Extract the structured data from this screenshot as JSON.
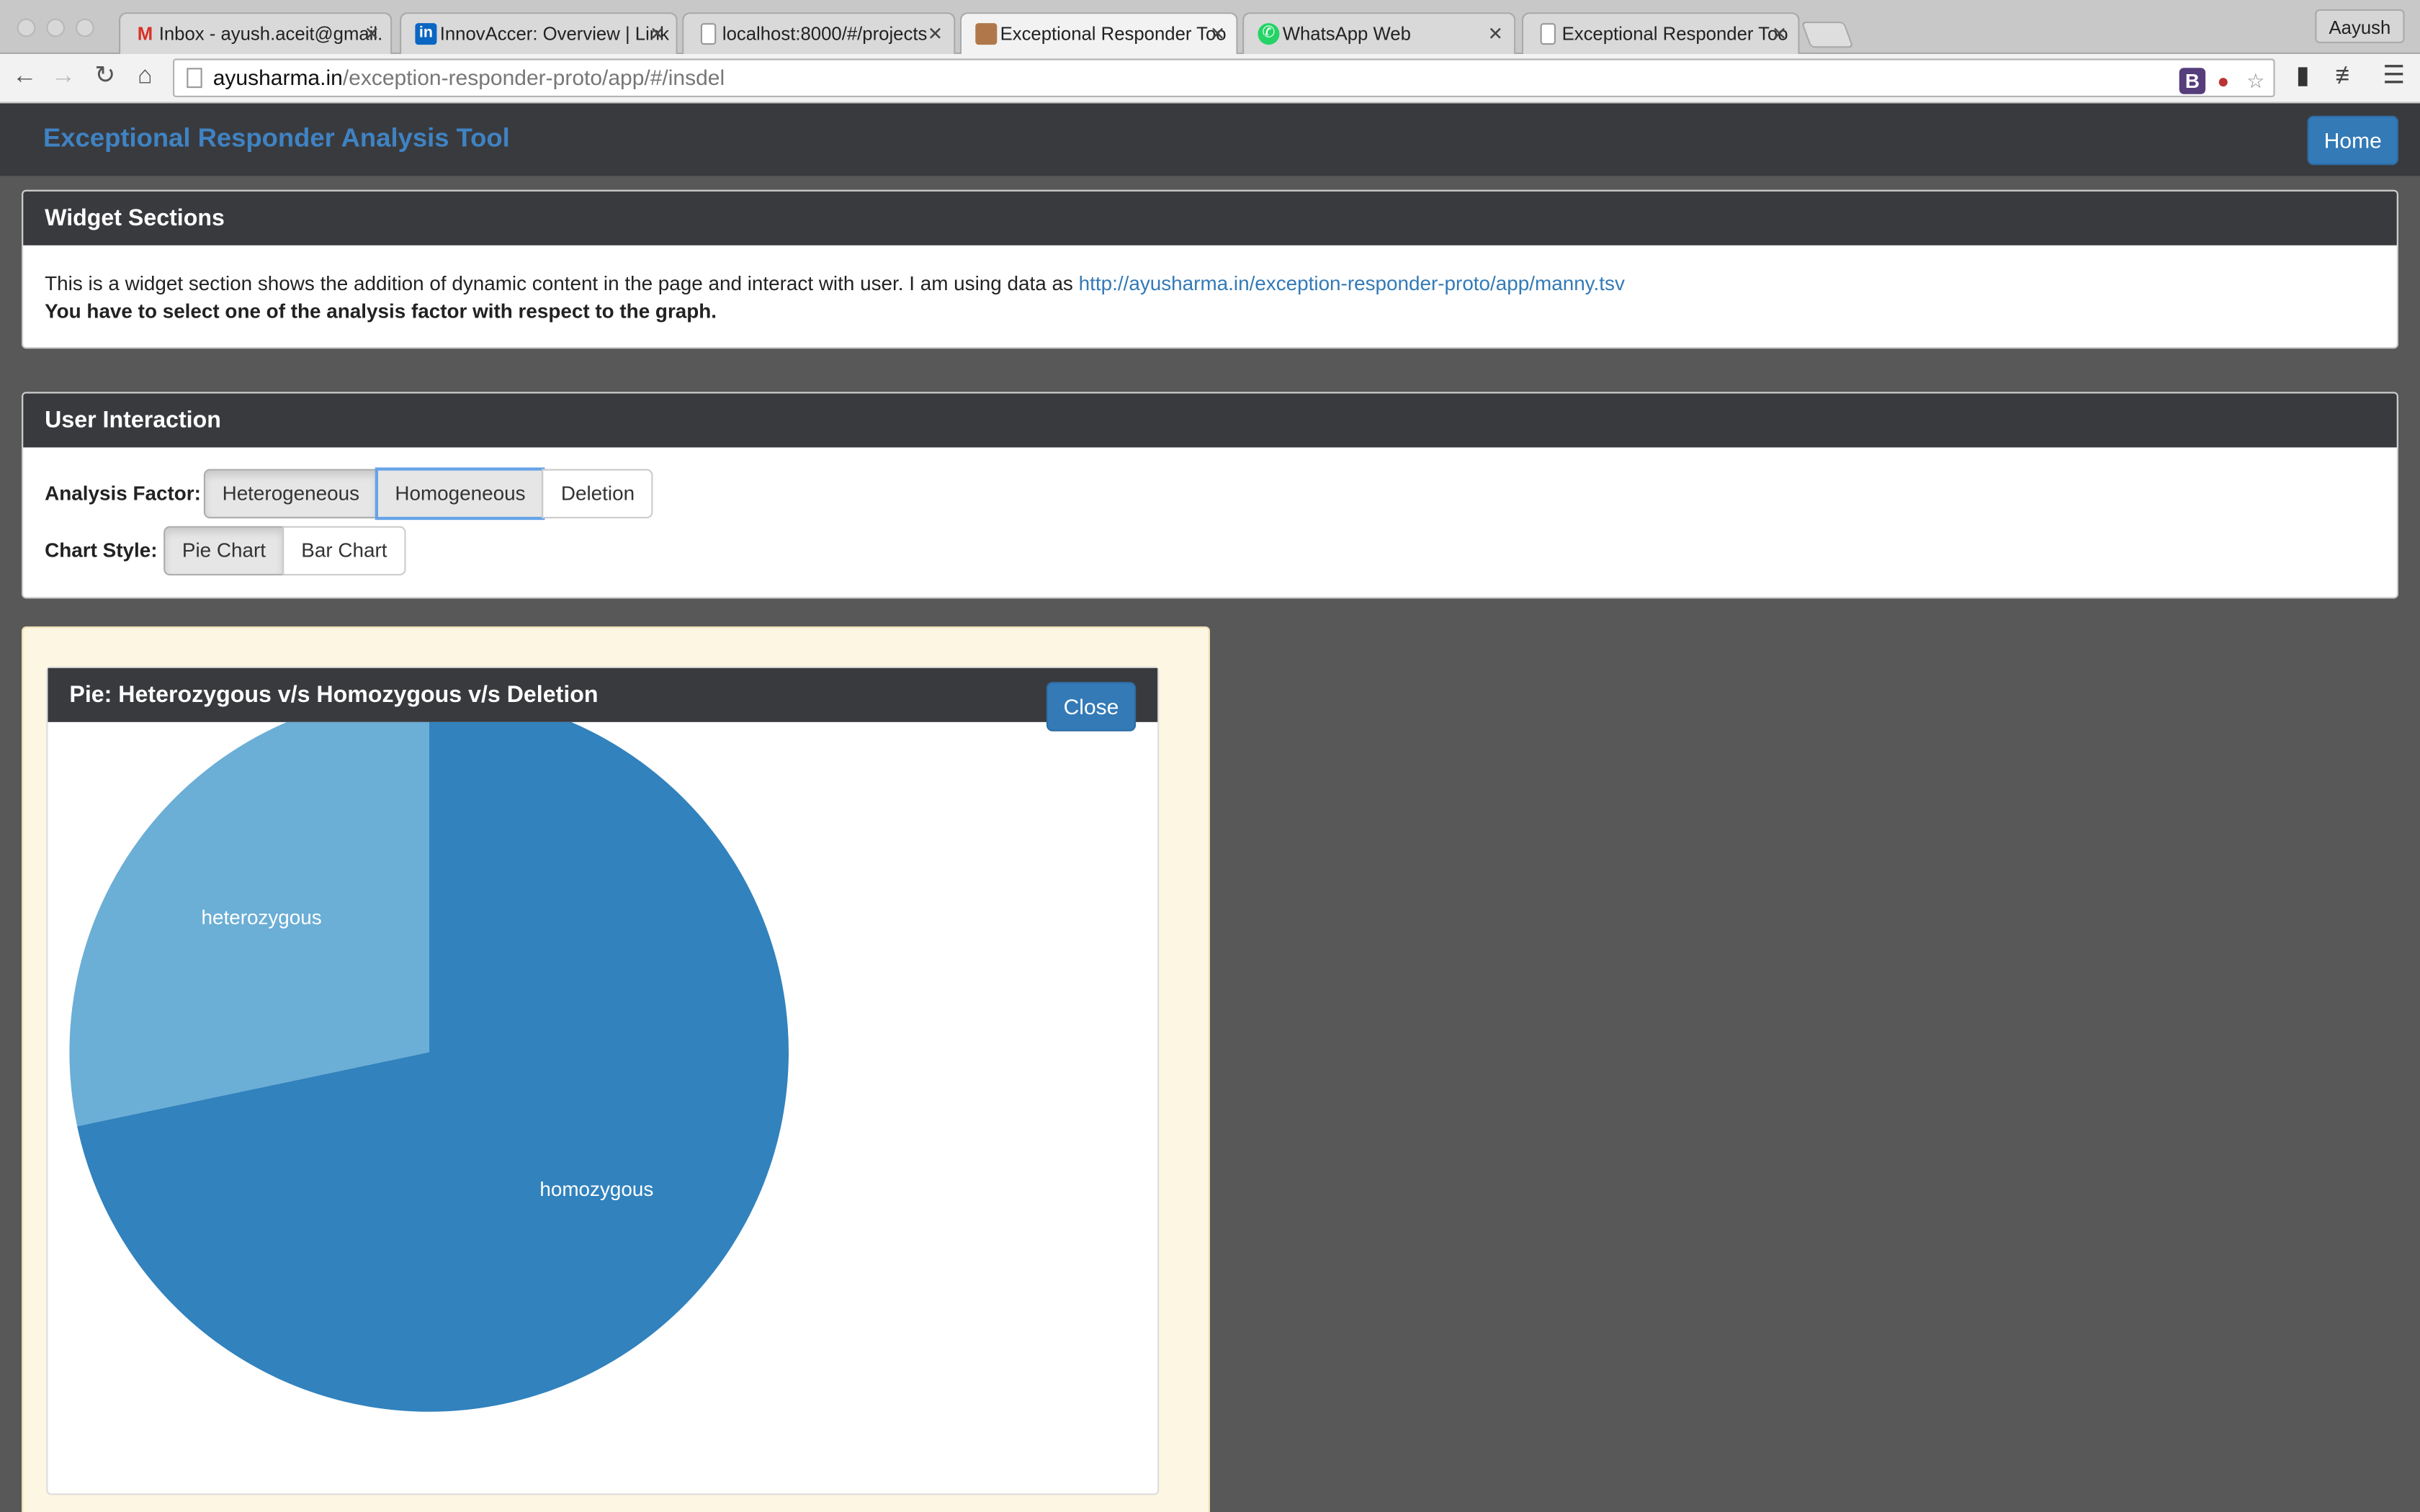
{
  "browser": {
    "tabs": [
      {
        "title": "Inbox - ayush.aceit@gmail.",
        "icon": "gmail-icon"
      },
      {
        "title": "InnovAccer: Overview | Link",
        "icon": "linkedin-icon"
      },
      {
        "title": "localhost:8000/#/projects",
        "icon": "page-icon"
      },
      {
        "title": "Exceptional Responder Too",
        "icon": "site-icon",
        "active": true
      },
      {
        "title": "WhatsApp Web",
        "icon": "whatsapp-icon"
      },
      {
        "title": "Exceptional Responder Too",
        "icon": "page-icon"
      }
    ],
    "profile": "Aayush",
    "url_host": "ayusharma.in",
    "url_path": "/exception-responder-proto/app/#/insdel"
  },
  "navbar": {
    "brand": "Exceptional Responder Analysis Tool",
    "home_label": "Home"
  },
  "widget_section": {
    "title": "Widget Sections",
    "description": "This is a widget section shows the addition of dynamic content in the page and interact with user. I am using data as",
    "data_link": "http://ayusharma.in/exception-responder-proto/app/manny.tsv",
    "instruction": "You have to select one of the analysis factor with respect to the graph."
  },
  "user_interaction": {
    "title": "User Interaction",
    "analysis_factor_label": "Analysis Factor:",
    "analysis_factors": [
      "Heterogeneous",
      "Homogeneous",
      "Deletion"
    ],
    "chart_style_label": "Chart Style:",
    "chart_styles": [
      "Pie Chart",
      "Bar Chart"
    ],
    "selected_chart_style": "Pie Chart"
  },
  "chart_panel": {
    "title": "Pie: Heterozygous v/s Homozygous v/s Deletion",
    "close_label": "Close"
  },
  "chart_data": {
    "type": "pie",
    "title": "Pie: Heterozygous v/s Homozygous v/s Deletion",
    "slices": [
      {
        "label": "homozygous",
        "value": 71.7,
        "color": "#3182bd"
      },
      {
        "label": "heterozygous",
        "value": 28.3,
        "color": "#6baed6"
      }
    ]
  },
  "colors": {
    "navbar_bg": "#393a3e",
    "brand": "#3f83c3",
    "primary": "#337ab7",
    "page_bg": "#585858",
    "chart_area_bg": "#fcf6e3"
  }
}
